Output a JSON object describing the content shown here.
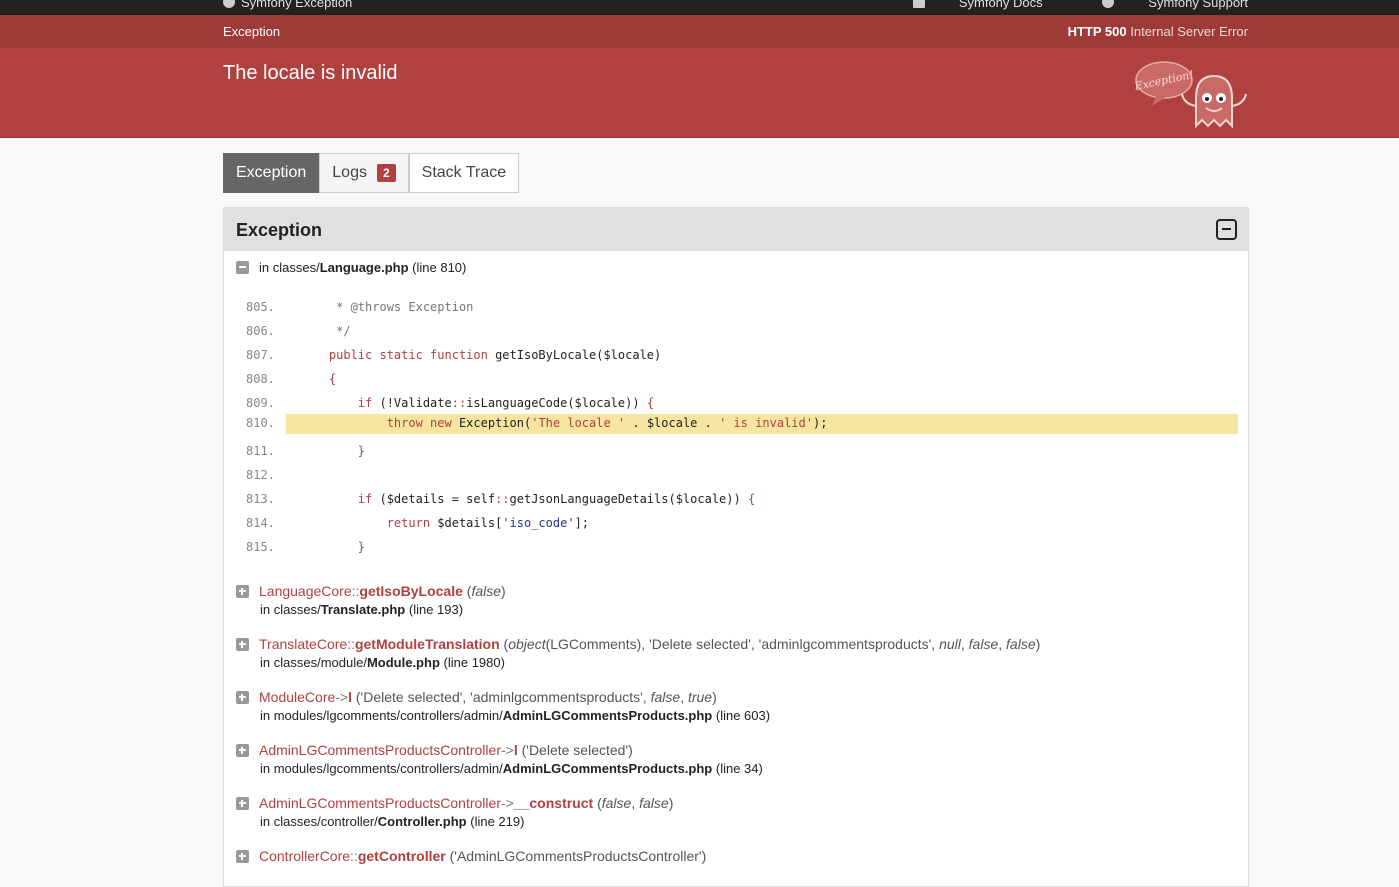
{
  "topbar": {
    "brand": "Symfony Exception",
    "docs_link": "Symfony Docs",
    "support_link": "Symfony Support"
  },
  "header": {
    "exception_class": "Exception",
    "status_code": "HTTP 500",
    "status_text": "Internal Server Error",
    "message": "The locale is invalid",
    "logo_text": "Exception!"
  },
  "tabs": [
    {
      "label": "Exception"
    },
    {
      "label": "Logs",
      "badge": "2"
    },
    {
      "label": "Stack Trace"
    }
  ],
  "panel": {
    "title": "Exception",
    "location_prefix": "in classes/",
    "location_file": "Language.php",
    "location_line": "(line 810)"
  },
  "code_lines": [
    {
      "num": "805."
    },
    {
      "num": "806."
    },
    {
      "num": "807."
    },
    {
      "num": "808."
    },
    {
      "num": "809."
    },
    {
      "num": "810."
    },
    {
      "num": "811."
    },
    {
      "num": "812."
    },
    {
      "num": "813."
    },
    {
      "num": "814."
    },
    {
      "num": "815."
    }
  ],
  "trace": [
    {
      "cls": "LanguageCore",
      "sep": "::",
      "fn": "getIsoByLocale",
      "dir": "in classes/",
      "file": "Translate.php",
      "line": "(line 193)"
    },
    {
      "cls": "TranslateCore",
      "sep": "::",
      "fn": "getModuleTranslation",
      "dir": "in classes/module/",
      "file": "Module.php",
      "line": "(line 1980)"
    },
    {
      "cls": "ModuleCore",
      "sep": "->",
      "fn": "l",
      "dir": "in modules/lgcomments/controllers/admin/",
      "file": "AdminLGCommentsProducts.php",
      "line": "(line 603)"
    },
    {
      "cls": "AdminLGCommentsProductsController",
      "sep": "->",
      "fn": "l",
      "dir": "in modules/lgcomments/controllers/admin/",
      "file": "AdminLGCommentsProducts.php",
      "line": "(line 34)"
    },
    {
      "cls": "AdminLGCommentsProductsController",
      "sep": "->",
      "fn": "__construct",
      "dir": "in classes/controller/",
      "file": "Controller.php",
      "line": "(line 219)"
    },
    {
      "cls": "ControllerCore",
      "sep": "::",
      "fn": "getController",
      "dir": "",
      "file": "",
      "line": ""
    }
  ]
}
